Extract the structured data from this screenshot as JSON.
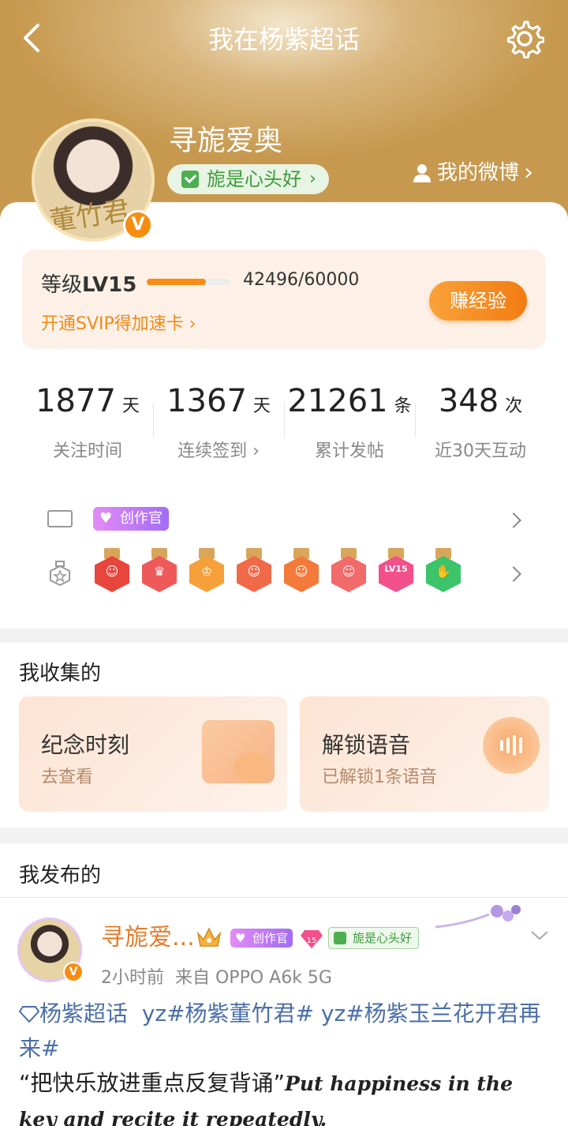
{
  "header": {
    "title": "我在杨紫超话"
  },
  "profile": {
    "avatar_caption": "董竹君",
    "username": "寻旎爱奥",
    "fan_badge": "旎是心头好",
    "my_weibo": "我的微博",
    "verified_mark": "V"
  },
  "level": {
    "prefix": "等级",
    "value": "LV15",
    "progress": 0.7083,
    "exp_text": "42496/60000",
    "svip_link": "开通SVIP得加速卡",
    "earn_button": "赚经验"
  },
  "stats": [
    {
      "number": "1877",
      "unit": "天",
      "label": "关注时间"
    },
    {
      "number": "1367",
      "unit": "天",
      "label": "连续签到"
    },
    {
      "number": "21261",
      "unit": "条",
      "label": "累计发帖"
    },
    {
      "number": "348",
      "unit": "次",
      "label": "近30天互动"
    }
  ],
  "badges": {
    "creator_label": "创作官",
    "medals": [
      {
        "icon": "cat-medal",
        "color": "#e8453c",
        "glyph": "☺"
      },
      {
        "icon": "trophy-medal",
        "color": "#ee5a5a",
        "glyph": "♛"
      },
      {
        "icon": "crown-medal",
        "color": "#f5a03a",
        "glyph": "♔"
      },
      {
        "icon": "cat-medal-2",
        "color": "#f06a4a",
        "glyph": "☺"
      },
      {
        "icon": "cat-medal-3",
        "color": "#f47a3a",
        "glyph": "☺"
      },
      {
        "icon": "rabbit-medal",
        "color": "#f26a6a",
        "glyph": "☺"
      },
      {
        "icon": "lv15-medal",
        "color": "#f2508a",
        "glyph": "LV15"
      },
      {
        "icon": "hand-medal",
        "color": "#3cc46a",
        "glyph": "✋"
      }
    ]
  },
  "collected": {
    "heading": "我收集的",
    "tiles": [
      {
        "title": "纪念时刻",
        "subtitle": "去查看"
      },
      {
        "title": "解锁语音",
        "subtitle": "已解锁1条语音"
      }
    ]
  },
  "published": {
    "heading": "我发布的",
    "post": {
      "author": "寻旎爱...",
      "creator_badge": "创作官",
      "level_badge": "15",
      "fan_badge": "旎是心头好",
      "time": "2小时前",
      "source": "来自 OPPO A6k 5G",
      "topic": "杨紫超话",
      "tags_line": "yz#杨紫董竹君# yz#杨紫玉兰花开君再来#",
      "quote_cn": "“把快乐放进重点反复背诵”",
      "quote_en": "Put happiness in the key and recite it repeatedly."
    }
  }
}
